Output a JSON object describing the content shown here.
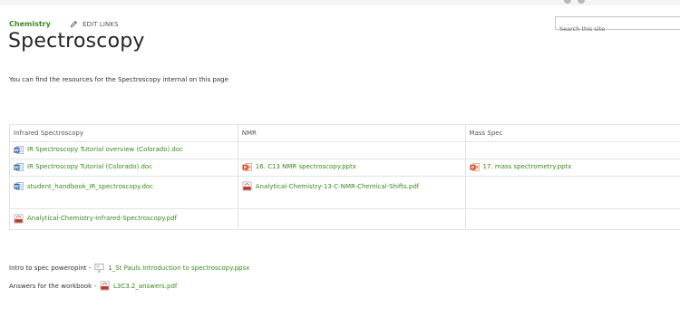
{
  "header": {
    "site_link": "Chemistry",
    "edit_links": "EDIT LINKS",
    "search_placeholder": "Search this site"
  },
  "page": {
    "title": "Spectroscopy",
    "intro": "You can find the resources for the Spectroscopy internal on this page"
  },
  "table": {
    "headers": [
      "Infrared Spectroscopy",
      "NMR",
      "Mass Spec"
    ],
    "rows": [
      [
        {
          "name": "IR Spectroscopy Tutorial overview (Colorado).doc",
          "icon": "word-doc-icon"
        },
        null,
        null
      ],
      [
        {
          "name": "IR Spectroscopy Tutorial (Colorado).doc",
          "icon": "word-doc-icon"
        },
        {
          "name": "16. C13 NMR spectroscopy.pptx",
          "icon": "powerpoint-icon"
        },
        {
          "name": "17. mass spectrometry.pptx",
          "icon": "powerpoint-icon"
        }
      ],
      [
        {
          "name": "student_handbook_IR_spectroscopy.doc",
          "icon": "word-doc-icon"
        },
        {
          "name": "Analytical-Chemistry-13-C-NMR-Chemical-Shifts.pdf",
          "icon": "pdf-icon"
        },
        null
      ],
      [
        {
          "name": "Analytical-Chemistry-Infrared-Spectroscopy.pdf",
          "icon": "pdf-icon"
        },
        null,
        null
      ]
    ]
  },
  "extras": {
    "line1_label": "Intro to spec poweropint -",
    "line1_file": "1_St Pauls Introduction to spectroscopy.ppsx",
    "line1_icon": "slideshow-icon",
    "line2_label": "Answers for the workbook -",
    "line2_file": "L3C3.2_answers.pdf",
    "line2_icon": "pdf-icon"
  },
  "colors": {
    "link": "#3a8a1e",
    "word": "#2b5797",
    "powerpoint": "#d24726",
    "pdf": "#c0392b"
  }
}
